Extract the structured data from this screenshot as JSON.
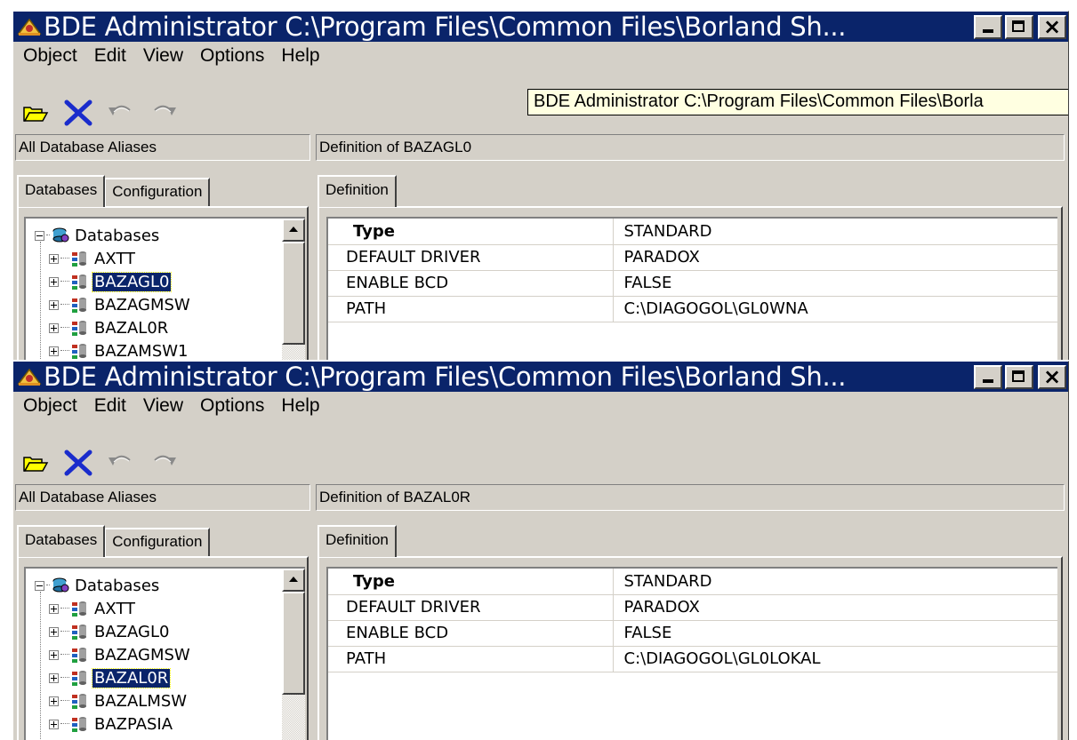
{
  "windows": [
    {
      "title": "BDE Administrator  C:\\Program Files\\Common Files\\Borland Sh...",
      "menu": [
        "Object",
        "Edit",
        "View",
        "Options",
        "Help"
      ],
      "tooltip": "BDE Administrator  C:\\Program Files\\Common Files\\Borla",
      "left_header": "All Database Aliases",
      "right_header": "Definition of BAZAGL0",
      "tabs_left": [
        "Databases",
        "Configuration"
      ],
      "tab_right": "Definition",
      "tree_root": "Databases",
      "tree_items": [
        "AXTT",
        "BAZAGL0",
        "BAZAGMSW",
        "BAZAL0R",
        "BAZAMSW1"
      ],
      "selected": "BAZAGL0",
      "table_header": [
        "Type",
        "STANDARD"
      ],
      "table_rows": [
        [
          "DEFAULT DRIVER",
          "PARADOX"
        ],
        [
          "ENABLE BCD",
          "FALSE"
        ],
        [
          "PATH",
          "C:\\DIAGOGOL\\GL0WNA"
        ]
      ]
    },
    {
      "title": "BDE Administrator  C:\\Program Files\\Common Files\\Borland Sh...",
      "menu": [
        "Object",
        "Edit",
        "View",
        "Options",
        "Help"
      ],
      "tooltip": "",
      "left_header": "All Database Aliases",
      "right_header": "Definition of BAZAL0R",
      "tabs_left": [
        "Databases",
        "Configuration"
      ],
      "tab_right": "Definition",
      "tree_root": "Databases",
      "tree_items": [
        "AXTT",
        "BAZAGL0",
        "BAZAGMSW",
        "BAZAL0R",
        "BAZALMSW",
        "BAZPASIA"
      ],
      "selected": "BAZAL0R",
      "table_header": [
        "Type",
        "STANDARD"
      ],
      "table_rows": [
        [
          "DEFAULT DRIVER",
          "PARADOX"
        ],
        [
          "ENABLE BCD",
          "FALSE"
        ],
        [
          "PATH",
          "C:\\DIAGOGOL\\GL0LOKAL"
        ]
      ]
    }
  ],
  "colors": {
    "titlebar": "#0a246a",
    "face": "#d4d0c8",
    "selection": "#0a246a",
    "tooltip_bg": "#ffffe1",
    "delete_icon": "#1a2ccc"
  },
  "icons": [
    "open-folder-icon",
    "delete-icon",
    "undo-icon",
    "redo-icon",
    "database-icon",
    "alias-icon",
    "minimize-icon",
    "maximize-icon",
    "close-icon"
  ]
}
